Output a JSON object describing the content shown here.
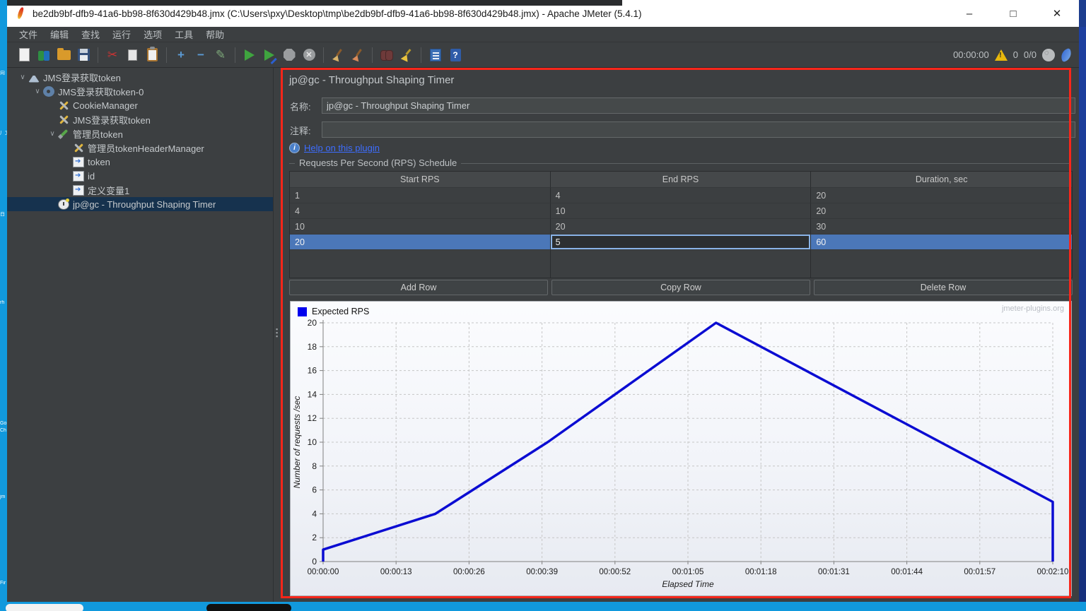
{
  "colors": {
    "red_frame": "#f8261a",
    "row_selection": "#4b77b8",
    "tree_selection": "#16324e",
    "link": "#3d6dff",
    "chart_line": "#0b0cd2",
    "legend_swatch": "#0000ee",
    "dark_bg": "#3c3f41",
    "chart_bg": "#f2f4f9"
  },
  "desktop": {
    "fragments": [
      "向",
      "厂文",
      "白",
      "rh",
      "Go",
      "Ch",
      "jm",
      "Fir"
    ]
  },
  "titlebar": {
    "title": "be2db9bf-dfb9-41a6-bb98-8f630d429b48.jmx (C:\\Users\\pxy\\Desktop\\tmp\\be2db9bf-dfb9-41a6-bb98-8f630d429b48.jmx) - Apache JMeter (5.4.1)",
    "minimize": "–",
    "maximize": "□",
    "close": "✕"
  },
  "menu": {
    "items": [
      "文件",
      "编辑",
      "查找",
      "运行",
      "选项",
      "工具",
      "帮助"
    ]
  },
  "toolbar": {
    "icons": [
      "new",
      "templates",
      "open",
      "save",
      "cut",
      "copy",
      "paste",
      "add",
      "remove",
      "toggle",
      "start",
      "start-no-timers",
      "stop",
      "shutdown",
      "clear",
      "clear-all",
      "search",
      "clear-search",
      "function-helper",
      "help"
    ],
    "timer": "00:00:00",
    "error_count": "0",
    "thread_count": "0/0"
  },
  "tree": {
    "items": [
      {
        "label": "JMS登录获取token",
        "icon": "flask",
        "depth": 0,
        "expanded": true,
        "selected": false
      },
      {
        "label": "JMS登录获取token-0",
        "icon": "gear",
        "depth": 1,
        "expanded": true,
        "selected": false
      },
      {
        "label": "CookieManager",
        "icon": "tools",
        "depth": 2,
        "expanded": null,
        "selected": false
      },
      {
        "label": "JMS登录获取token",
        "icon": "tools",
        "depth": 2,
        "expanded": null,
        "selected": false
      },
      {
        "label": "管理员token",
        "icon": "dropper",
        "depth": 2,
        "expanded": true,
        "selected": false
      },
      {
        "label": "管理员tokenHeaderManager",
        "icon": "tools",
        "depth": 3,
        "expanded": null,
        "selected": false
      },
      {
        "label": "token",
        "icon": "doc-arrow",
        "depth": 3,
        "expanded": null,
        "selected": false
      },
      {
        "label": "id",
        "icon": "doc-arrow",
        "depth": 3,
        "expanded": null,
        "selected": false
      },
      {
        "label": "定义变量1",
        "icon": "doc-arrow",
        "depth": 3,
        "expanded": null,
        "selected": false
      },
      {
        "label": "jp@gc - Throughput Shaping Timer",
        "icon": "clock",
        "depth": 2,
        "expanded": null,
        "selected": true
      }
    ]
  },
  "panel": {
    "title": "jp@gc - Throughput Shaping Timer",
    "name_label": "名称:",
    "name_value": "jp@gc - Throughput Shaping Timer",
    "comment_label": "注释:",
    "comment_value": "",
    "help_link": "Help on this plugin",
    "group_title": "Requests Per Second (RPS) Schedule",
    "table": {
      "headers": [
        "Start RPS",
        "End RPS",
        "Duration, sec"
      ],
      "rows": [
        [
          "1",
          "4",
          "20"
        ],
        [
          "4",
          "10",
          "20"
        ],
        [
          "10",
          "20",
          "30"
        ],
        [
          "20",
          "5",
          "60"
        ]
      ],
      "selected_row": 3,
      "editing_cell": {
        "row": 3,
        "col": 1,
        "value": "5"
      }
    },
    "buttons": [
      "Add Row",
      "Copy Row",
      "Delete Row"
    ]
  },
  "chart_data": {
    "type": "line",
    "legend": "Expected RPS",
    "watermark": "jmeter-plugins.org",
    "xlabel": "Elapsed Time",
    "ylabel": "Number of requests /sec",
    "xlim": [
      0,
      130
    ],
    "ylim": [
      0,
      20
    ],
    "x_tick_seconds": [
      0,
      13,
      26,
      39,
      52,
      65,
      78,
      91,
      104,
      117,
      130
    ],
    "x_tick_labels": [
      "00:00:00",
      "00:00:13",
      "00:00:26",
      "00:00:39",
      "00:00:52",
      "00:01:05",
      "00:01:18",
      "00:01:31",
      "00:01:44",
      "00:01:57",
      "00:02:10"
    ],
    "y_ticks": [
      0,
      2,
      4,
      6,
      8,
      10,
      12,
      14,
      16,
      18,
      20
    ],
    "points": [
      [
        0,
        0
      ],
      [
        0,
        1
      ],
      [
        20,
        4
      ],
      [
        40,
        10
      ],
      [
        70,
        20
      ],
      [
        130,
        5
      ],
      [
        130,
        0
      ]
    ],
    "line_color": "#0b0cd2",
    "grid": true,
    "legend_position": "top-left"
  }
}
